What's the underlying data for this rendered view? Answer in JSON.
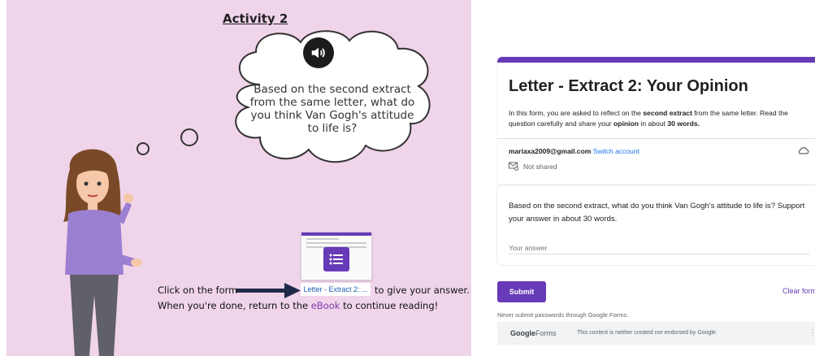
{
  "slide": {
    "activity_title": "Activity 2",
    "cloud_text": "Based on the second extract from the same letter, what do you think Van Gogh's attitude to life is?",
    "speaker_icon": "speaker-icon",
    "form_thumbnail_label": "Letter - Extract 2: ...",
    "instruction_1_prefix": "Click on the form",
    "instruction_1_suffix": "to give your answer.",
    "instruction_2_prefix": "When you're done, return to the ",
    "instruction_2_link": "eBook",
    "instruction_2_suffix": " to continue reading!",
    "background_color": "#f0d4ea",
    "link_color": "#7a3aa8"
  },
  "form": {
    "title": "Letter - Extract 2: Your Opinion",
    "description_1": "In this form, you are asked to reflect on the ",
    "description_bold_1": "second extract",
    "description_2": " from the same letter. Read the question carefully and share your ",
    "description_bold_2": "opinion",
    "description_3": " in about ",
    "description_bold_3": "30 words.",
    "account_email": "mariaxa2009@gmail.com",
    "switch_account": "Switch account",
    "not_shared": "Not shared",
    "question": "Based on the second extract, what do you think Van Gogh's attitude to life is? Support your answer in about 30 words.",
    "answer_placeholder": "Your answer",
    "submit_label": "Submit",
    "clear_label": "Clear form",
    "never_submit": "Never submit passwords through Google Forms.",
    "footer_logo_1": "Google",
    "footer_logo_2": "Forms",
    "footer_note": "This content is neither created nor endorsed by Google.",
    "accent_color": "#673ab7"
  }
}
